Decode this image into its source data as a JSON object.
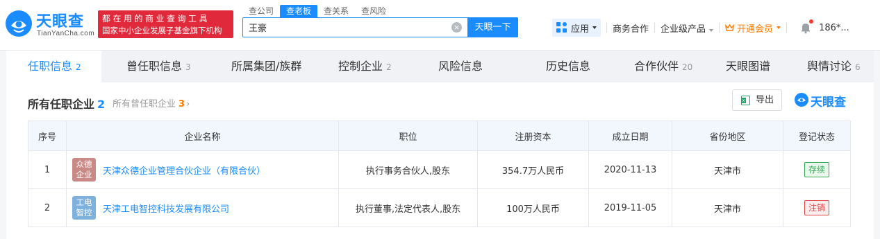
{
  "header": {
    "logo_text": "天眼查",
    "logo_sub": "TianYanCha.com",
    "slogan_line1": "都在用的商业查询工具",
    "slogan_line2": "国家中小企业发展子基金旗下机构",
    "search_tabs": [
      "查公司",
      "查老板",
      "查关系",
      "查风险"
    ],
    "search_value": "王豪",
    "search_button": "天眼一下",
    "apps_label": "应用",
    "business": "商务合作",
    "enterprise_products": "企业级产品",
    "vip_label": "开通会员",
    "user": "186*..."
  },
  "tabs": [
    {
      "label": "任职信息",
      "count": "2"
    },
    {
      "label": "曾任职信息",
      "count": "3"
    },
    {
      "label": "所属集团/族群",
      "count": ""
    },
    {
      "label": "控制企业",
      "count": "2"
    },
    {
      "label": "风险信息",
      "count": ""
    },
    {
      "label": "历史信息",
      "count": ""
    },
    {
      "label": "合作伙伴",
      "count": "20"
    },
    {
      "label": "天眼图谱",
      "count": ""
    },
    {
      "label": "舆情讨论",
      "count": "6"
    }
  ],
  "section": {
    "title": "所有任职企业",
    "title_count": "2",
    "sub": "所有曾任职企业",
    "sub_count": "3",
    "export_label": "导出",
    "watermark": "天眼查"
  },
  "table": {
    "columns": [
      "序号",
      "企业名称",
      "职位",
      "注册资本",
      "成立日期",
      "省份地区",
      "登记状态"
    ],
    "rows": [
      {
        "index": "1",
        "logo_line1": "众德",
        "logo_line2": "企业",
        "logo_color": "#c98a87",
        "name": "天津众德企业管理合伙企业（有限合伙）",
        "position": "执行事务合伙人,股东",
        "capital": "354.7万人民币",
        "date": "2020-11-13",
        "region": "天津市",
        "status": "存续",
        "status_color": "#35a853",
        "status_bg": "#eaf7ec"
      },
      {
        "index": "2",
        "logo_line1": "工电",
        "logo_line2": "智控",
        "logo_color": "#7fb1dd",
        "name": "天津工电智控科技发展有限公司",
        "position": "执行董事,法定代表人,股东",
        "capital": "100万人民币",
        "date": "2019-11-05",
        "region": "天津市",
        "status": "注销",
        "status_color": "#e64545",
        "status_bg": "#fdecec"
      }
    ]
  },
  "colors": {
    "accent": "#1a8cff",
    "brand_red": "#e0293a",
    "vip_orange": "#ff7a00"
  }
}
